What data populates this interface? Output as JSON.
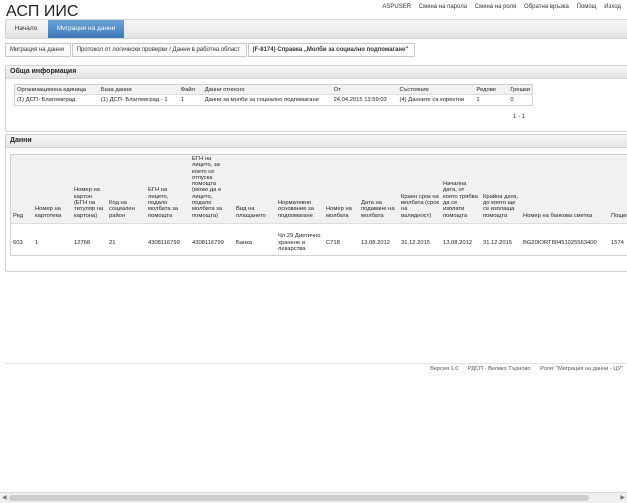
{
  "app": {
    "title": "АСП ИИС"
  },
  "toplinks": [
    "ASPUSER",
    "Смяна на парола",
    "Смяна на роля",
    "Обратна връзка",
    "Помощ",
    "Изход"
  ],
  "nav": {
    "home": "Начало",
    "active": "Миграция на данни"
  },
  "breadcrumb": [
    "Миграция на данни",
    "Протокол от логически проверки / Данни в работна област",
    "(F-8174) Справка „Молби за социално подпомагане\""
  ],
  "general": {
    "title": "Обща информация",
    "headers": [
      "Организационна единица",
      "База данни",
      "Файл",
      "Данни относно",
      "От",
      "Състояние",
      "Редове",
      "Грешки"
    ],
    "row": [
      "(1) ДСП- Благоевград",
      "(1) ДСП- Благоевград - 1",
      "1",
      "Данни за молби за социално подпомагане",
      "24.04.2015 13:59:03",
      "(4) Данните са коректни",
      "1",
      "0"
    ],
    "pager": "1 - 1"
  },
  "data": {
    "title": "Данни",
    "headers": [
      "Ред",
      "Номер на картотека",
      "Номер на картон (ЕГН на титуляр на картона)",
      "Код на социален район",
      "ЕГН на лицето, подало молбата за помощта",
      "ЕГН на лицето, за което се отпуска помощта (може да е лицето, подало молбата за помощта)",
      "Вид на плащането",
      "Нормативно основание за подпомагане",
      "Номер на молбата",
      "Дата на подаване на молбата",
      "Краен срок на молбата (срок на валидност)",
      "Начална дата, от която трябва да се изплати помощта",
      "Крайна дата, до която ще се изплаща помощта",
      "Номер на банкова сметка",
      "Пощенски код"
    ],
    "row": [
      "603",
      "1",
      "12768",
      "21",
      "4308116799",
      "4308116799",
      "Банка",
      "Чл.29 Диетично хранене и лекарства",
      "С718",
      "13.08.2012",
      "31.12.2015",
      "13.08.2012",
      "31.12.2015",
      "BG20IORT80451025563400",
      "1574"
    ]
  },
  "footer": {
    "version": "Версия 1.0",
    "org": "РДСП - Велико Търново",
    "role": "Роля: \"Миграция на данни - ЦУ\""
  }
}
